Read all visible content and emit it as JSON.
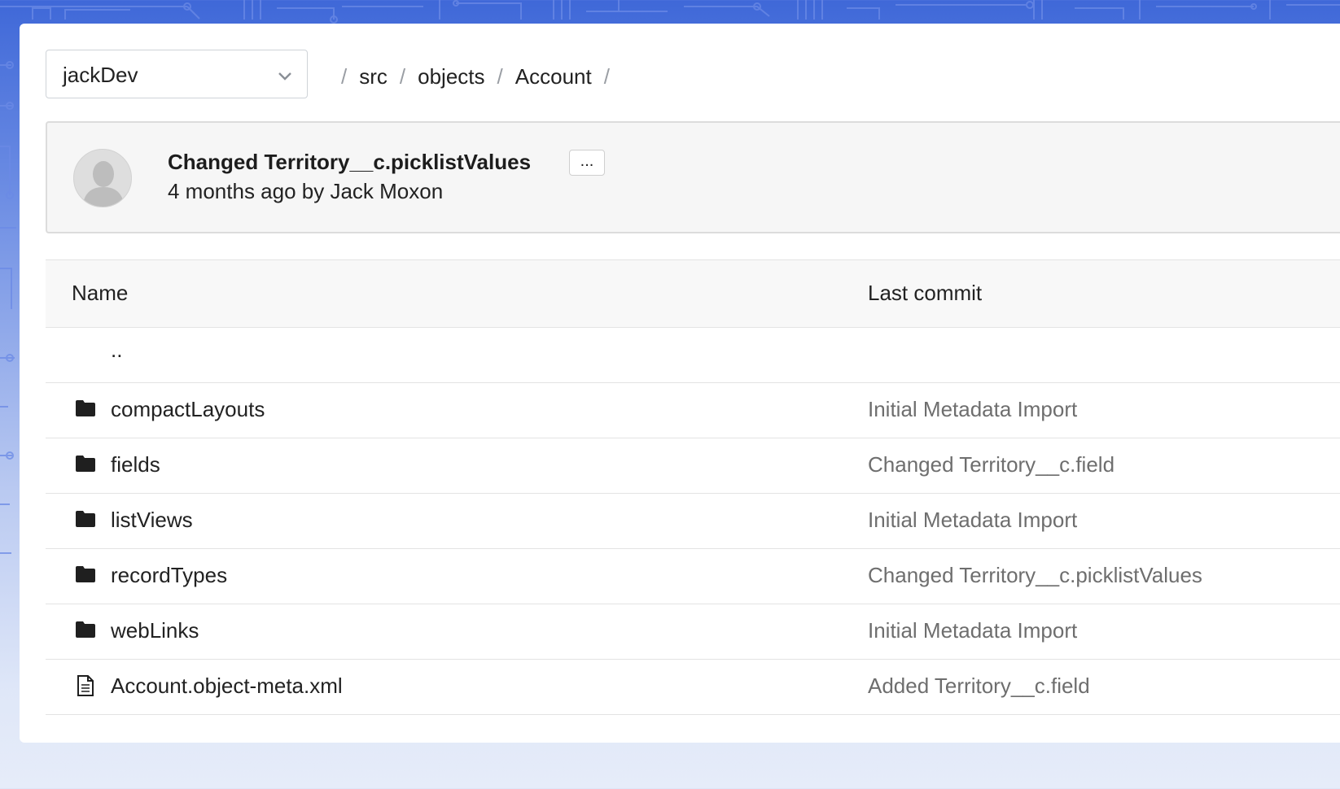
{
  "branch_selector": {
    "value": "jackDev"
  },
  "breadcrumb": {
    "separator": "/",
    "items": [
      "src",
      "objects",
      "Account"
    ]
  },
  "commit": {
    "title": "Changed Territory__c.picklistValues",
    "more_label": "...",
    "meta": "4 months ago by Jack Moxon"
  },
  "table": {
    "headers": {
      "name": "Name",
      "last_commit": "Last commit"
    },
    "parent_dir": "..",
    "rows": [
      {
        "type": "folder",
        "name": "compactLayouts",
        "last_commit": "Initial Metadata Import"
      },
      {
        "type": "folder",
        "name": "fields",
        "last_commit": "Changed Territory__c.field"
      },
      {
        "type": "folder",
        "name": "listViews",
        "last_commit": "Initial Metadata Import"
      },
      {
        "type": "folder",
        "name": "recordTypes",
        "last_commit": "Changed Territory__c.picklistValues"
      },
      {
        "type": "folder",
        "name": "webLinks",
        "last_commit": "Initial Metadata Import"
      },
      {
        "type": "file",
        "name": "Account.object-meta.xml",
        "last_commit": "Added Territory__c.field"
      }
    ]
  },
  "icons": {
    "folder": "folder-icon",
    "file": "file-icon",
    "dropdown": "chevron-down-icon",
    "avatar": "user-avatar-icon"
  },
  "colors": {
    "background_top": "#3f68d8",
    "background_bottom": "#e6ecf9",
    "panel": "#ffffff",
    "muted_text": "#6e6e6e"
  }
}
